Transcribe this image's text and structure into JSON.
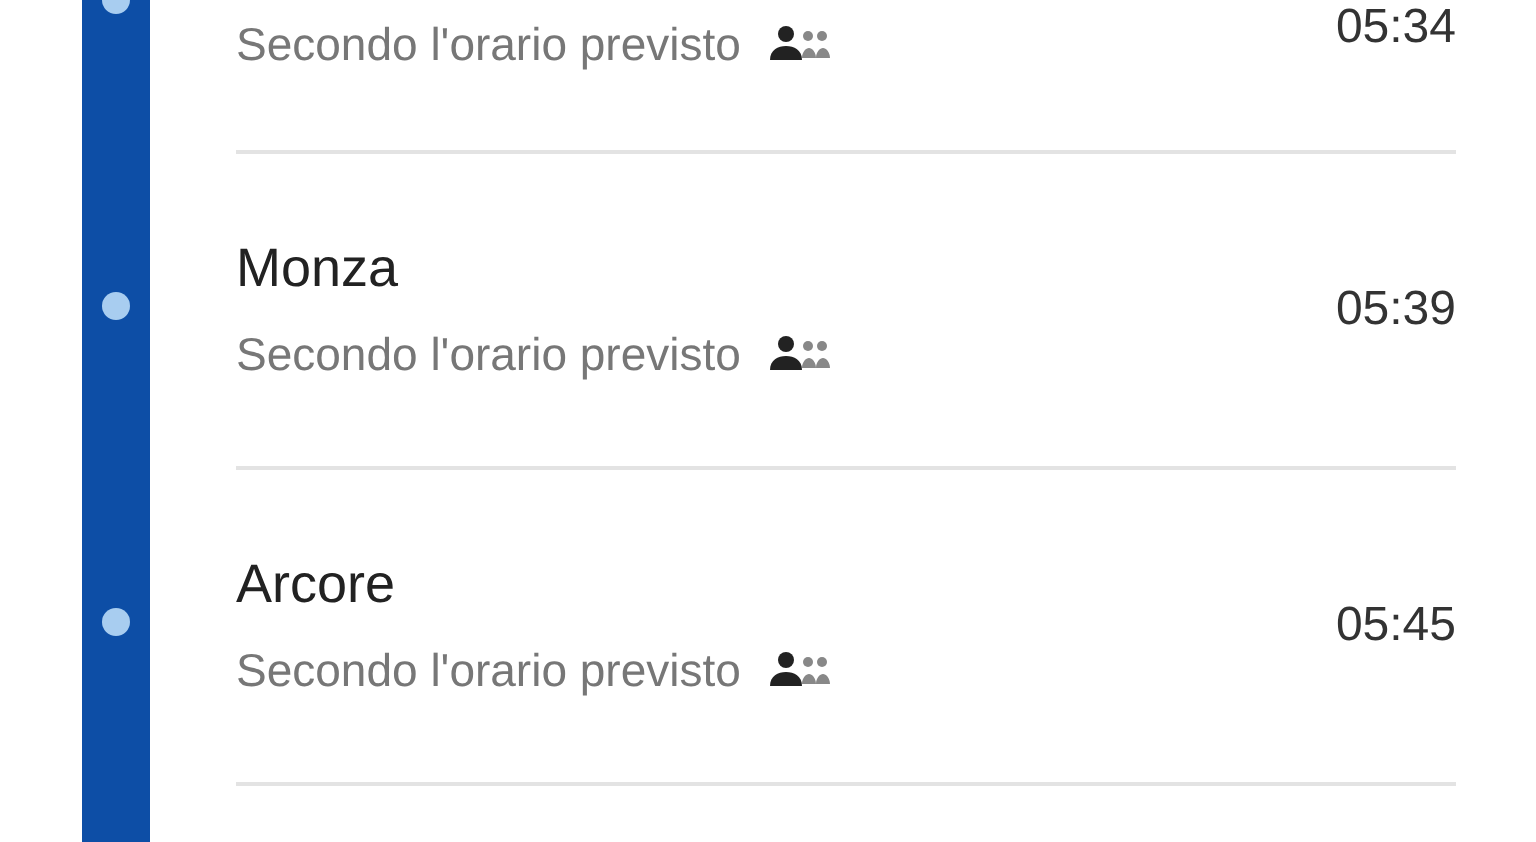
{
  "stops": [
    {
      "status": "Secondo l'orario previsto",
      "time": "05:34"
    },
    {
      "name": "Monza",
      "status": "Secondo l'orario previsto",
      "time": "05:39"
    },
    {
      "name": "Arcore",
      "status": "Secondo l'orario previsto",
      "time": "05:45"
    }
  ]
}
